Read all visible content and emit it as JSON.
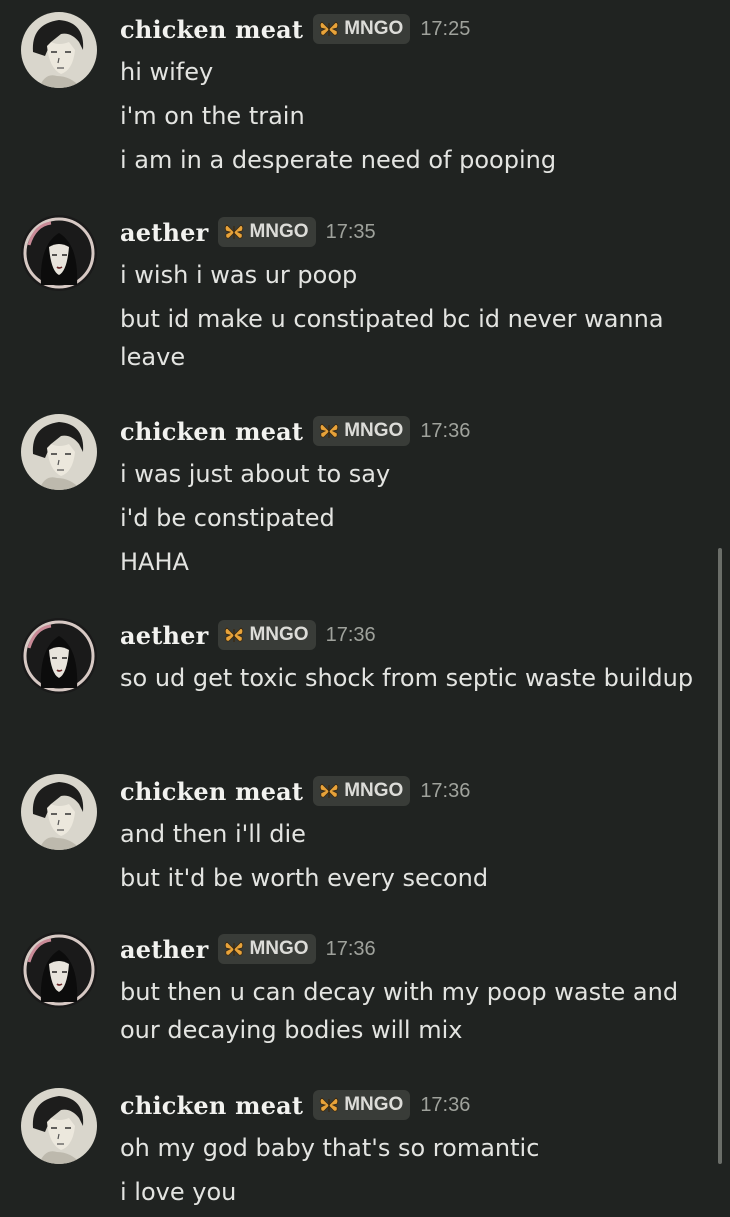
{
  "messages": [
    {
      "user": "chicken meat",
      "tag": "MNGO",
      "time": "17:25",
      "avatar": "chicken-meat-avatar",
      "lines": [
        "hi wifey",
        "i'm on the train",
        "i am in a desperate need of pooping"
      ]
    },
    {
      "user": "aether",
      "tag": "MNGO",
      "time": "17:35",
      "avatar": "aether-avatar",
      "lines": [
        "i wish i was ur poop",
        "but id make u constipated bc id never wanna leave"
      ]
    },
    {
      "user": "chicken meat",
      "tag": "MNGO",
      "time": "17:36",
      "avatar": "chicken-meat-avatar",
      "lines": [
        "i was just about to say",
        "i'd be constipated",
        "HAHA"
      ]
    },
    {
      "user": "aether",
      "tag": "MNGO",
      "time": "17:36",
      "avatar": "aether-avatar",
      "lines": [
        "so ud get toxic shock from septic waste buildup"
      ]
    },
    {
      "user": "chicken meat",
      "tag": "MNGO",
      "time": "17:36",
      "avatar": "chicken-meat-avatar",
      "lines": [
        "and then i'll die",
        "but it'd be worth every second"
      ]
    },
    {
      "user": "aether",
      "tag": "MNGO",
      "time": "17:36",
      "avatar": "aether-avatar",
      "lines": [
        "but then u can decay with my poop waste and our decaying bodies will mix"
      ]
    },
    {
      "user": "chicken meat",
      "tag": "MNGO",
      "time": "17:36",
      "avatar": "chicken-meat-avatar",
      "lines": [
        "oh my god baby that's so romantic",
        "i love you"
      ]
    }
  ],
  "tag_icon": "butterfly-icon",
  "colors": {
    "background": "#202321",
    "username": "#f2f2ef",
    "tag_bg": "#393c38",
    "butterfly": "#e8a33a",
    "time": "#9fa29c",
    "text": "#e3e4e1"
  }
}
